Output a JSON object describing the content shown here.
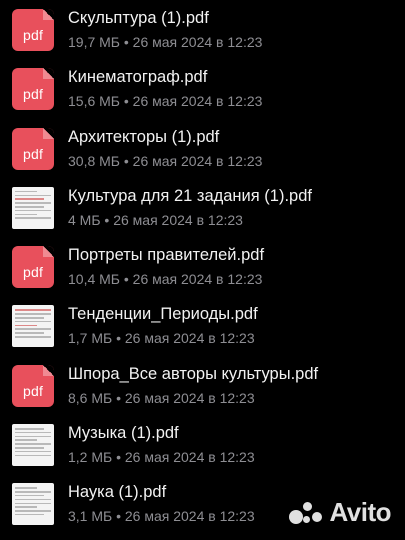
{
  "files": [
    {
      "name": "Скульптура (1).pdf",
      "meta": "19,7 МБ • 26 мая 2024 в 12:23",
      "icon": "pdf-file-icon",
      "thumb_label": "pdf"
    },
    {
      "name": "Кинематограф.pdf",
      "meta": "15,6 МБ • 26 мая 2024 в 12:23",
      "icon": "pdf-file-icon",
      "thumb_label": "pdf"
    },
    {
      "name": "Архитекторы (1).pdf",
      "meta": "30,8 МБ • 26 мая 2024 в 12:23",
      "icon": "pdf-file-icon",
      "thumb_label": "pdf"
    },
    {
      "name": "Культура для 21 задания (1).pdf",
      "meta": "4 МБ • 26 мая 2024 в 12:23",
      "icon": "document-thumbnail",
      "thumb_label": ""
    },
    {
      "name": "Портреты правителей.pdf",
      "meta": "10,4 МБ • 26 мая 2024 в 12:23",
      "icon": "pdf-file-icon",
      "thumb_label": "pdf"
    },
    {
      "name": "Тенденции_Периоды.pdf",
      "meta": "1,7 МБ • 26 мая 2024 в 12:23",
      "icon": "document-thumbnail",
      "thumb_label": ""
    },
    {
      "name": "Шпора_Все авторы культуры.pdf",
      "meta": "8,6 МБ • 26 мая 2024 в 12:23",
      "icon": "pdf-file-icon",
      "thumb_label": "pdf"
    },
    {
      "name": "Музыка (1).pdf",
      "meta": "1,2 МБ • 26 мая 2024 в 12:23",
      "icon": "document-thumbnail",
      "thumb_label": ""
    },
    {
      "name": "Наука (1).pdf",
      "meta": "3,1 МБ • 26 мая 2024 в 12:23",
      "icon": "document-thumbnail",
      "thumb_label": ""
    }
  ],
  "watermark": {
    "text": "Avito",
    "icon": "avito-logo-icon"
  },
  "colors": {
    "background": "#000000",
    "pdf_icon": "#e8505c",
    "title": "#f2f2f2",
    "meta": "#8e8e93"
  }
}
